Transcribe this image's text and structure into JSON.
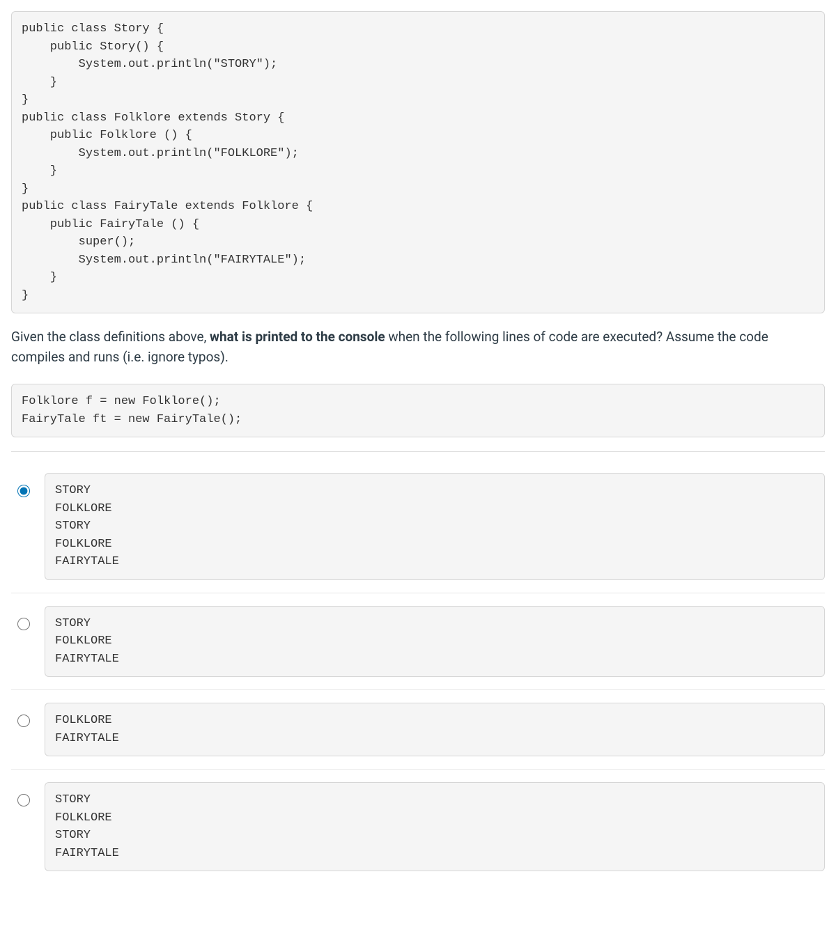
{
  "code_block_1": "public class Story {\n    public Story() {\n        System.out.println(\"STORY\");\n    }\n}\npublic class Folklore extends Story {\n    public Folklore () {\n        System.out.println(\"FOLKLORE\");\n    }\n}\npublic class FairyTale extends Folklore {\n    public FairyTale () {\n        super();\n        System.out.println(\"FAIRYTALE\");\n    }\n}",
  "question": {
    "prefix": "Given the class definitions above, ",
    "bold": "what is printed to the console",
    "suffix": " when the following lines of code are executed? Assume the code compiles and runs (i.e. ignore typos)."
  },
  "code_block_2": "Folklore f = new Folklore();\nFairyTale ft = new FairyTale();",
  "answers": [
    {
      "text": "STORY\nFOLKLORE\nSTORY\nFOLKLORE\nFAIRYTALE",
      "selected": true
    },
    {
      "text": "STORY\nFOLKLORE\nFAIRYTALE",
      "selected": false
    },
    {
      "text": "FOLKLORE\nFAIRYTALE",
      "selected": false
    },
    {
      "text": "STORY\nFOLKLORE\nSTORY\nFAIRYTALE",
      "selected": false
    }
  ]
}
